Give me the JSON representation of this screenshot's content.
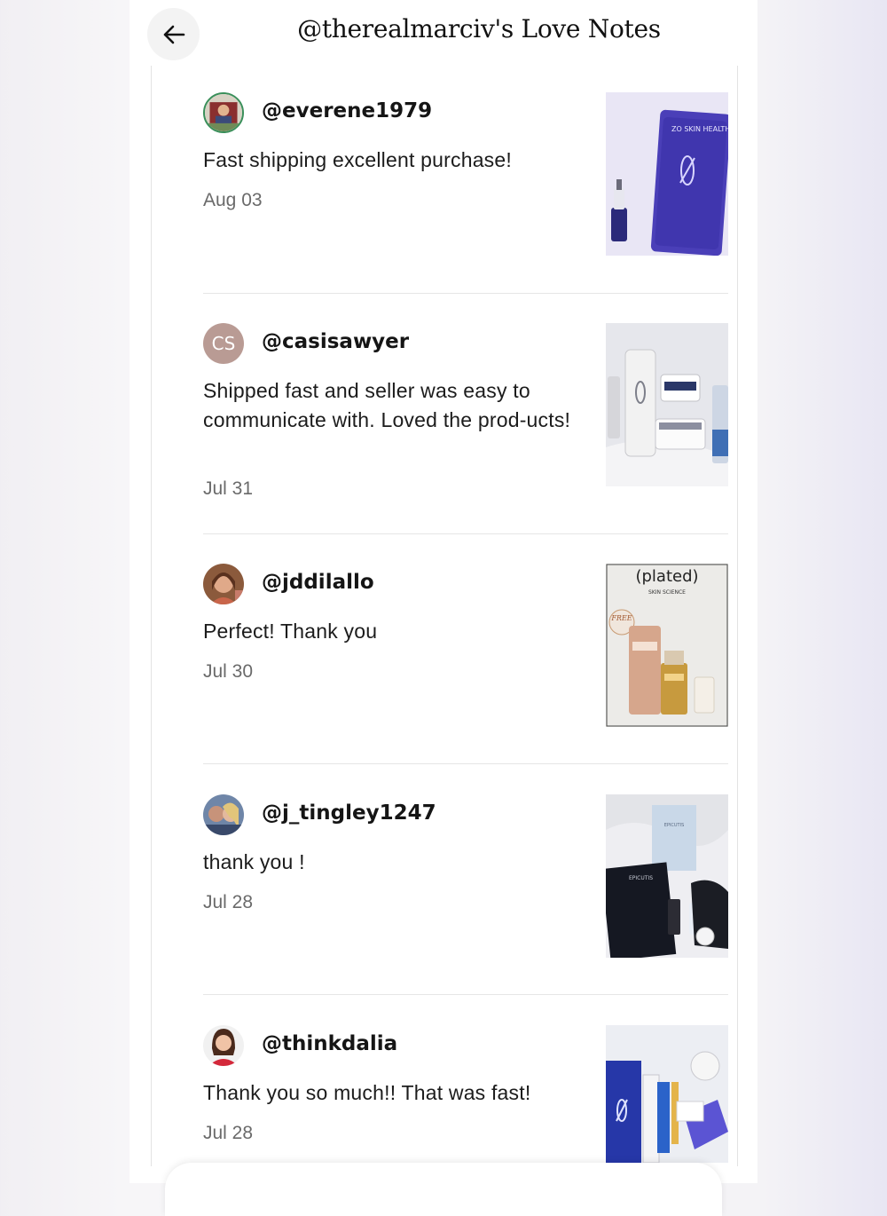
{
  "header": {
    "title": "@therealmarciv's Love Notes",
    "back_icon": "arrow-left-icon"
  },
  "notes": [
    {
      "user": "@everene1979",
      "comment": "Fast shipping excellent purchase!",
      "date": "Aug 03"
    },
    {
      "user": "@casisawyer",
      "initials": "CS",
      "comment": "Shipped fast and seller was easy to communicate with. Loved the prod-ucts!",
      "date": "Jul 31"
    },
    {
      "user": "@jddilallo",
      "comment": "Perfect! Thank you",
      "date": "Jul 30"
    },
    {
      "user": "@j_tingley1247",
      "comment": "thank you !",
      "date": "Jul 28"
    },
    {
      "user": "@thinkdalia",
      "comment": "Thank you so much!! That was fast!",
      "date": "Jul 28"
    }
  ],
  "thumb_text": {
    "zo_brand": "ZO SKIN HEALTH",
    "plated_brand": "(plated)",
    "plated_sub": "SKIN SCIENCE",
    "plated_free": "FREE",
    "epicutis_brand": "EPICUTIS"
  },
  "colors": {
    "zo_purple": "#4a3fb8",
    "avatar_cs": "#b99b94"
  }
}
